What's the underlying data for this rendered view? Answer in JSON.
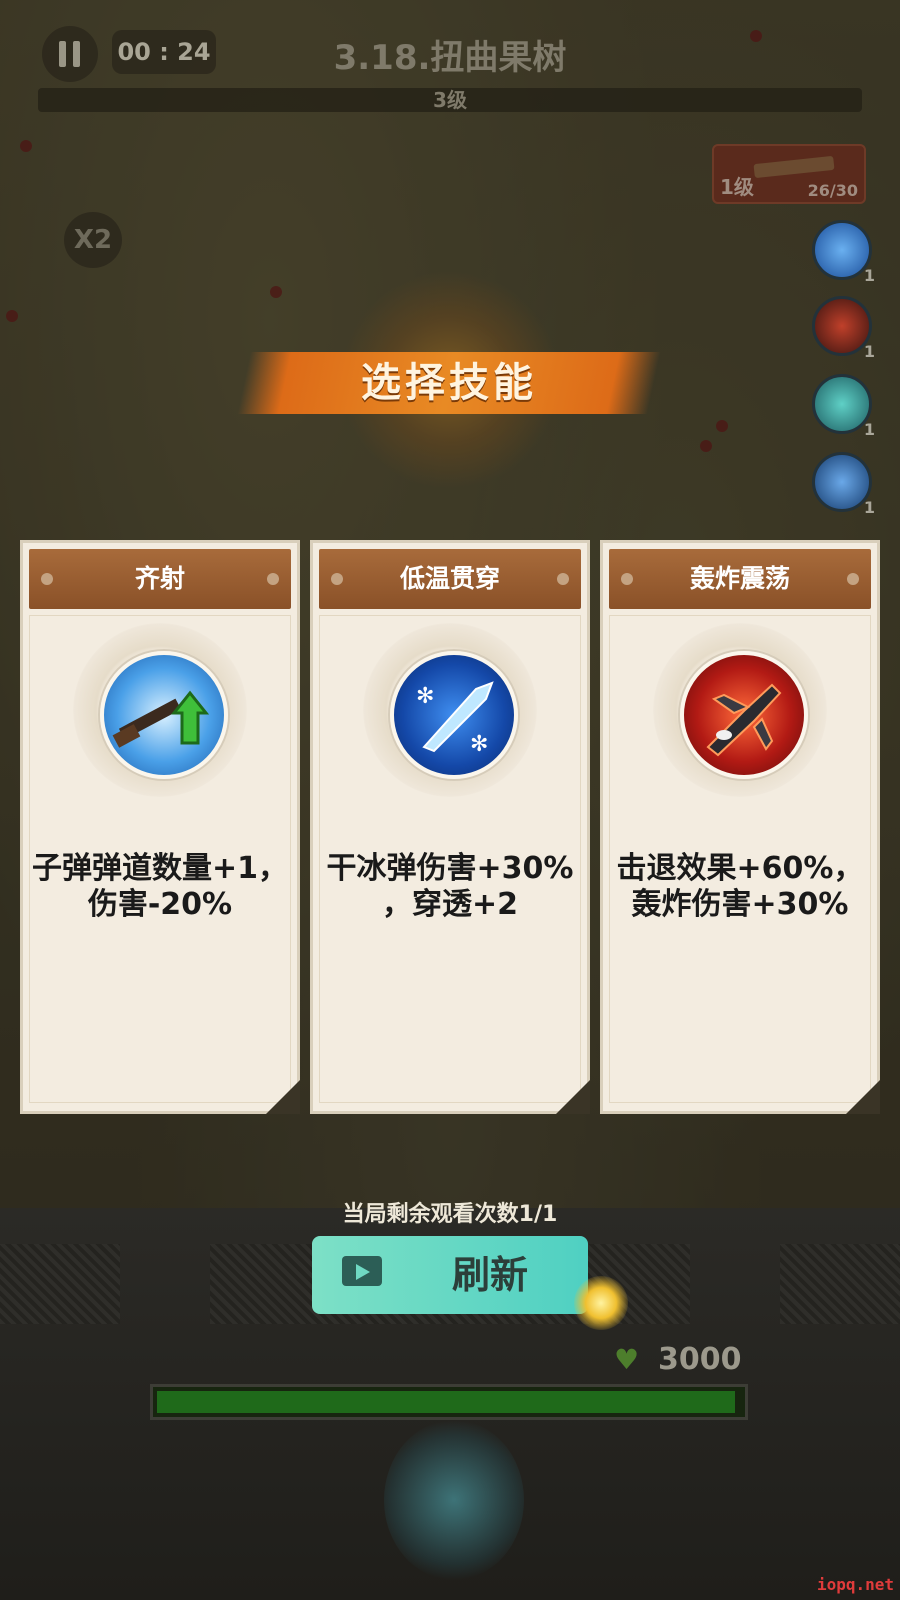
{
  "hud": {
    "timer": "00 : 24",
    "stage_title": "3.18.扭曲果树",
    "wave_level": "3级",
    "speed_multiplier": "X2",
    "weapon": {
      "level": "1级",
      "count": "26/30"
    },
    "skills": [
      {
        "icon": "blue-wave-skill-icon",
        "level": "1"
      },
      {
        "icon": "red-blade-skill-icon",
        "level": "1"
      },
      {
        "icon": "teal-slash-skill-icon",
        "level": "1"
      },
      {
        "icon": "ice-shard-skill-icon",
        "level": "1"
      }
    ]
  },
  "dialog": {
    "title": "选择技能",
    "cards": [
      {
        "name": "齐射",
        "icon": "rifle-upgrade-icon",
        "desc_line1": "子弹弹道数量+1，",
        "desc_line2": "伤害-20%"
      },
      {
        "name": "低温贯穿",
        "icon": "ice-bullet-icon",
        "desc_line1": "干冰弹伤害+30%",
        "desc_line2": "，穿透+2"
      },
      {
        "name": "轰炸震荡",
        "icon": "bomber-jet-icon",
        "desc_line1": "击退效果+60%，",
        "desc_line2": "轰炸伤害+30%"
      }
    ],
    "watch_remaining": "当局剩余观看次数1/1",
    "refresh_label": "刷新"
  },
  "base": {
    "hp_value": "3000",
    "hp_fraction": 1.0
  },
  "watermark": "iopq.net"
}
